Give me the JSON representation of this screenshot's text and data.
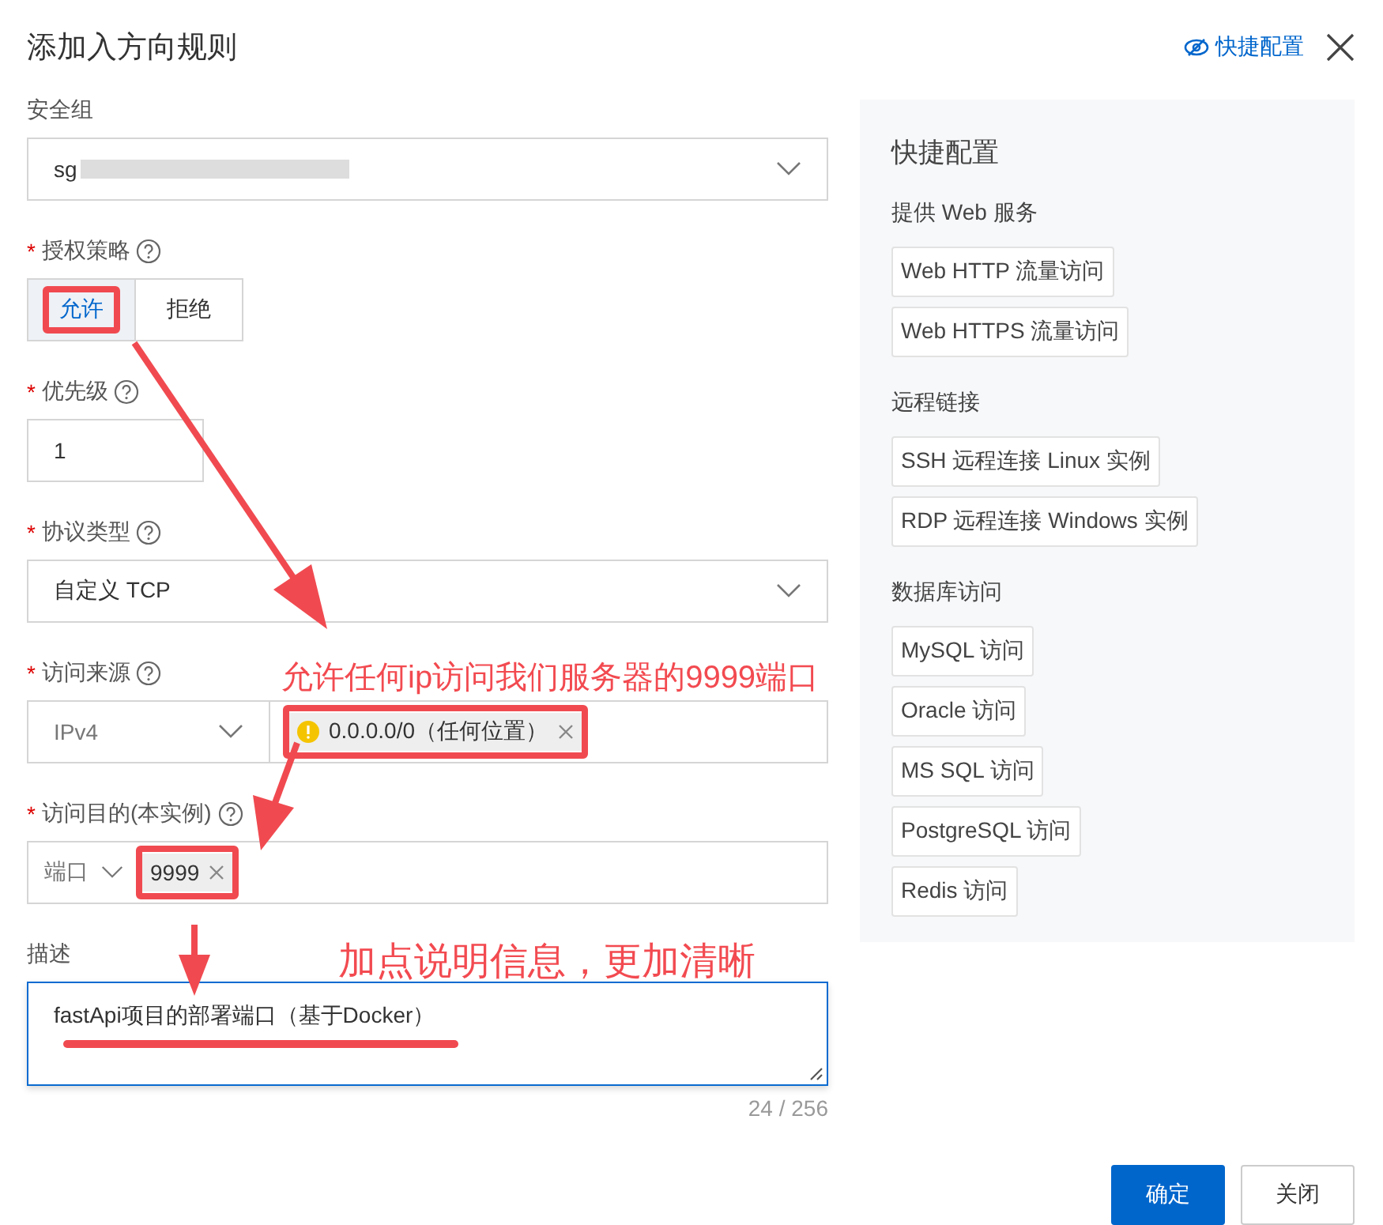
{
  "dialog": {
    "title": "添加入方向规则",
    "quick_config_link": "快捷配置"
  },
  "form": {
    "fields": [
      {
        "kind": "select",
        "label": "安全组",
        "value": "sg",
        "redacted": true
      },
      {
        "kind": "segmented",
        "label": "授权策略",
        "required_mark": "*",
        "help": true,
        "options": [
          {
            "label": "允许",
            "selected": true,
            "highlighted": true
          },
          {
            "label": "拒绝",
            "selected": false,
            "highlighted": false
          }
        ]
      },
      {
        "kind": "number",
        "label": "优先级",
        "required_mark": "*",
        "help": true,
        "value": "1"
      },
      {
        "kind": "select",
        "label": "协议类型",
        "required_mark": "*",
        "help": true,
        "value": "自定义 TCP"
      },
      {
        "kind": "source",
        "label": "访问来源",
        "required_mark": "*",
        "help": true,
        "protocol": "IPv4",
        "tags": [
          {
            "text": "0.0.0.0/0（任何位置）",
            "warning": true,
            "highlighted": true
          }
        ]
      },
      {
        "kind": "dest",
        "label": "访问目的(本实例)",
        "required_mark": "*",
        "help": true,
        "port_type": "端口",
        "tags": [
          {
            "text": "9999",
            "warning": false,
            "highlighted": true
          }
        ]
      },
      {
        "kind": "textarea",
        "label": "描述",
        "value": "fastApi项目的部署端口（基于Docker）",
        "focused": true,
        "underlined": true,
        "counter": "24 / 256"
      }
    ]
  },
  "quick_panel": {
    "title": "快捷配置",
    "sections": [
      {
        "heading": "提供 Web 服务",
        "items": [
          "Web HTTP 流量访问",
          "Web HTTPS 流量访问"
        ]
      },
      {
        "heading": "远程链接",
        "items": [
          "SSH 远程连接 Linux 实例",
          "RDP 远程连接 Windows 实例"
        ]
      },
      {
        "heading": "数据库访问",
        "items": [
          "MySQL 访问",
          "Oracle 访问",
          "MS SQL 访问",
          "PostgreSQL 访问",
          "Redis 访问"
        ]
      }
    ]
  },
  "footer": {
    "buttons": [
      {
        "label": "确定",
        "kind": "primary"
      },
      {
        "label": "关闭",
        "kind": "default"
      }
    ]
  },
  "annotations": [
    {
      "text": "允许任何ip访问我们服务器的9999端口"
    },
    {
      "text": "加点说明信息，更加清晰"
    }
  ]
}
